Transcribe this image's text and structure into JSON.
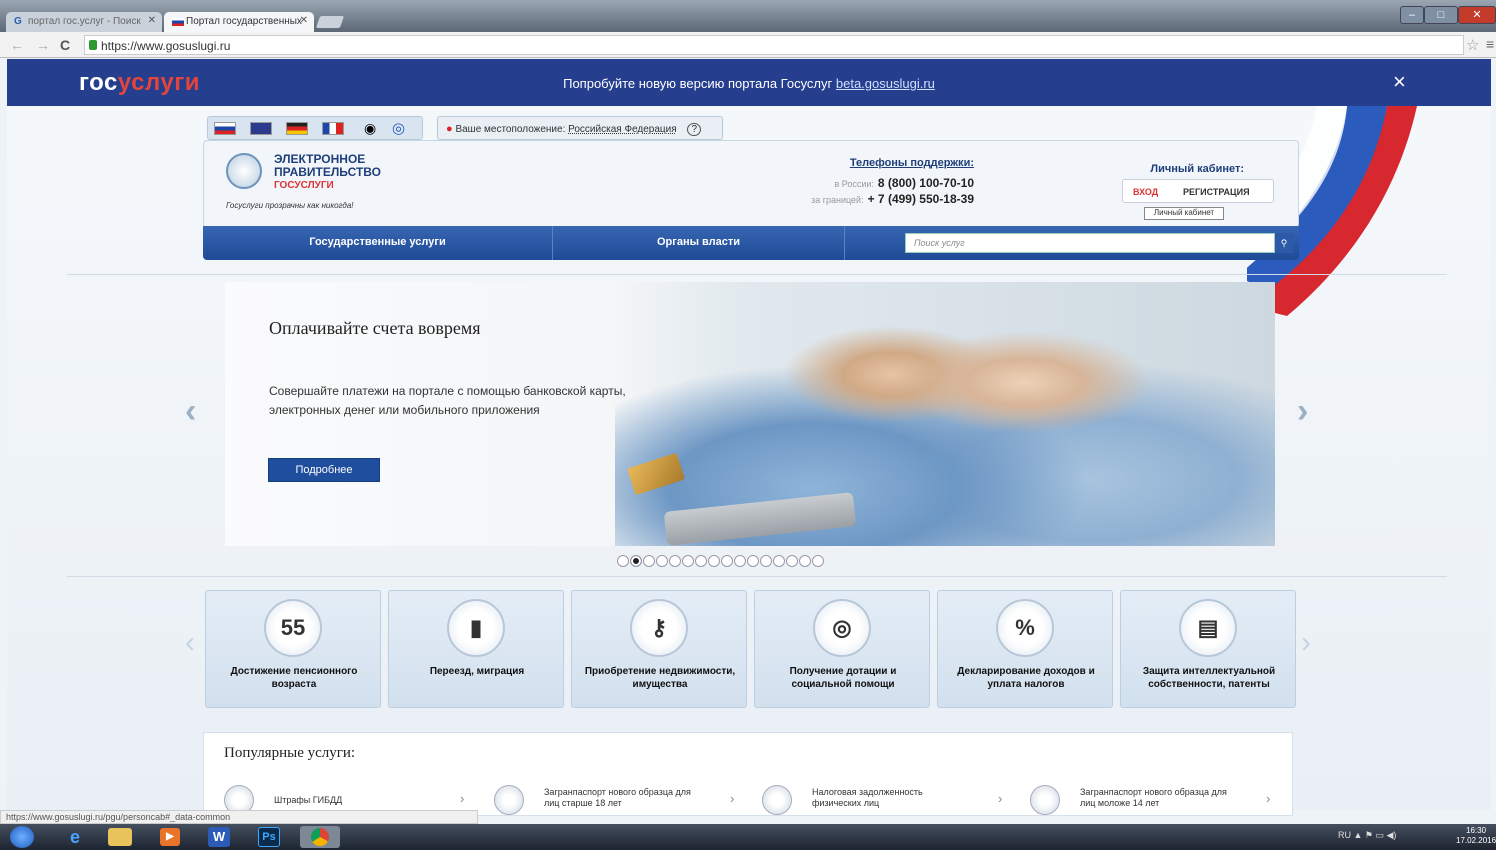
{
  "browser": {
    "tabs": [
      {
        "label": "портал гос.услуг - Поиск"
      },
      {
        "label": "Портал государственных"
      }
    ],
    "url": "https://www.gosuslugi.ru",
    "status_url": "https://www.gosuslugi.ru/pgu/personcab#_data-common"
  },
  "banner": {
    "logo_part1": "гос",
    "logo_part2": "услуги",
    "message": "Попробуйте новую версию портала Госуслуг",
    "link": "beta.gosuslugi.ru",
    "close": "×"
  },
  "toolbar": {
    "location_label": "Ваше местоположение:",
    "location_value": "Российская Федерация",
    "help": "?"
  },
  "header": {
    "egov_line1": "ЭЛЕКТРОННОЕ",
    "egov_line2": "ПРАВИТЕЛЬСТВО",
    "egov_line3": "ГОСУСЛУГИ",
    "slogan": "Госуслуги прозрачны как никогда!",
    "phones_title": "Телефоны поддержки:",
    "phone_ru_label": "в России:",
    "phone_ru": "8 (800) 100-70-10",
    "phone_abroad_label": "за границей:",
    "phone_abroad": "+ 7 (499) 550-18-39",
    "cabinet_title": "Личный кабинет:",
    "login": "ВХОД",
    "register": "РЕГИСТРАЦИЯ",
    "tooltip": "Личный кабинет"
  },
  "nav": {
    "items": [
      "Государственные услуги",
      "Органы власти"
    ],
    "search_placeholder": "Поиск услуг"
  },
  "slider": {
    "title": "Оплачивайте счета вовремя",
    "text": "Совершайте платежи на портале с помощью банковской карты, электронных денег или мобильного приложения",
    "button": "Подробнее",
    "dot_count": 16,
    "active_dot": 1
  },
  "categories": [
    {
      "label": "Достижение пенсионного возраста",
      "icon": "calendar-55-icon",
      "glyph": "55"
    },
    {
      "label": "Переезд, миграция",
      "icon": "passport-icon",
      "glyph": "▮"
    },
    {
      "label": "Приобретение недвижимости, имущества",
      "icon": "keys-icon",
      "glyph": "⚷"
    },
    {
      "label": "Получение дотации и социальной помощи",
      "icon": "lifebuoy-icon",
      "glyph": "◎"
    },
    {
      "label": "Декларирование доходов и уплата налогов",
      "icon": "percent-icon",
      "glyph": "%"
    },
    {
      "label": "Защита интеллектуальной собственности, патенты",
      "icon": "certificate-icon",
      "glyph": "▤"
    }
  ],
  "popular": {
    "title": "Популярные услуги:",
    "items": [
      {
        "label": "Штрафы ГИБДД",
        "icon": "traffic-light-icon"
      },
      {
        "label": "Загранпаспорт нового образца для лиц старше 18 лет",
        "icon": "passport-icon"
      },
      {
        "label": "Налоговая задолженность физических лиц",
        "icon": "tax-icon"
      },
      {
        "label": "Загранпаспорт нового образца для лиц моложе 14 лет",
        "icon": "passport-icon"
      }
    ]
  },
  "taskbar": {
    "lang": "RU",
    "time": "16:30",
    "date": "17.02.2016"
  },
  "colors": {
    "brand_blue": "#253e8e",
    "brand_red": "#e2453b",
    "nav_blue": "#1f4a96"
  }
}
